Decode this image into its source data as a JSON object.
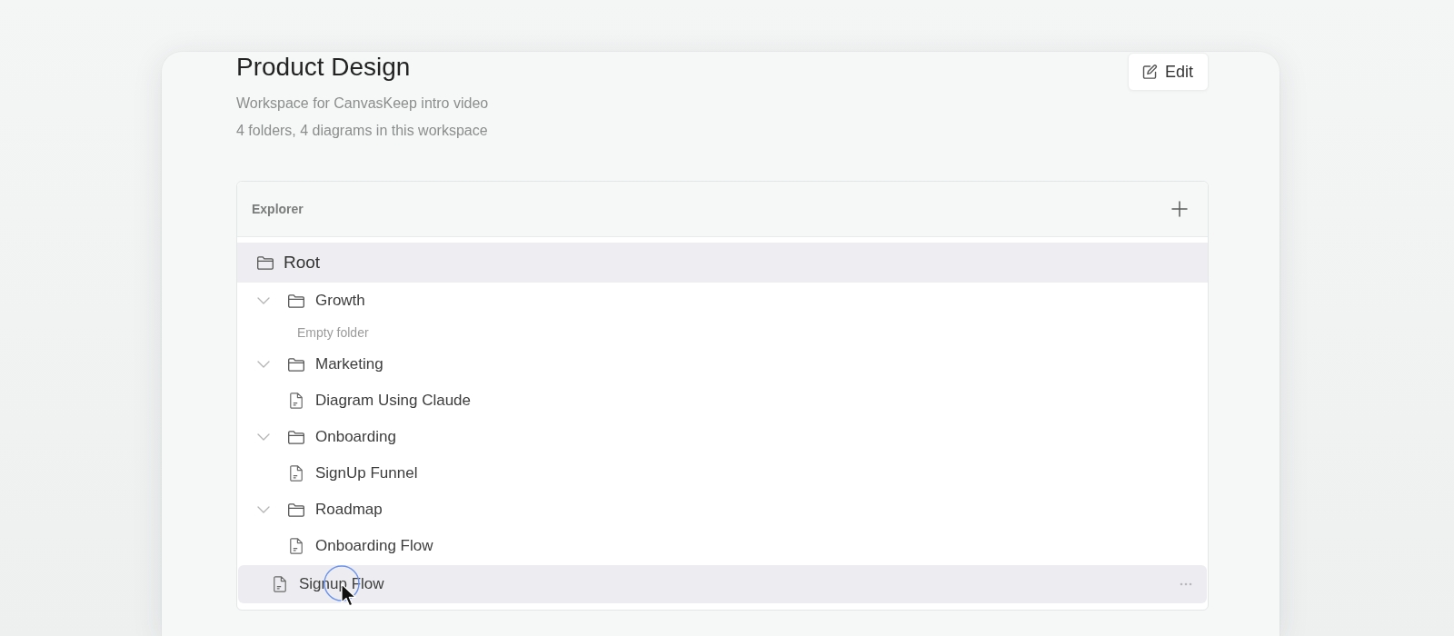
{
  "workspace": {
    "title": "Product Design",
    "description": "Workspace for CanvasKeep intro video",
    "summary": "4 folders, 4 diagrams in this workspace"
  },
  "edit_button": {
    "label": "Edit"
  },
  "explorer": {
    "title": "Explorer",
    "root": {
      "label": "Root",
      "children": [
        {
          "kind": "folder",
          "label": "Growth",
          "expanded": true,
          "hovered": false,
          "empty_label": "Empty folder"
        },
        {
          "kind": "folder",
          "label": "Marketing",
          "expanded": true,
          "hovered": false,
          "children": [
            {
              "kind": "diagram",
              "label": "Diagram Using Claude",
              "hovered": false
            }
          ]
        },
        {
          "kind": "folder",
          "label": "Onboarding",
          "expanded": true,
          "hovered": false,
          "children": [
            {
              "kind": "diagram",
              "label": "SignUp Funnel",
              "hovered": false
            }
          ]
        },
        {
          "kind": "folder",
          "label": "Roadmap",
          "expanded": true,
          "hovered": false,
          "children": [
            {
              "kind": "diagram",
              "label": "Onboarding Flow",
              "hovered": false
            }
          ]
        },
        {
          "kind": "diagram",
          "label": "Signup Flow",
          "hovered": true
        }
      ]
    }
  }
}
